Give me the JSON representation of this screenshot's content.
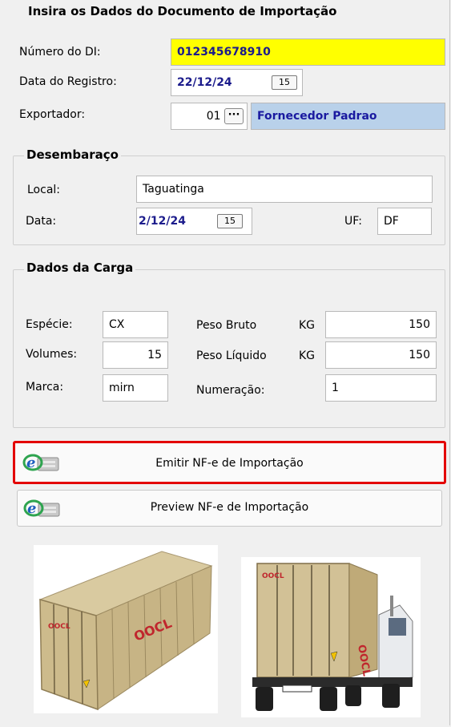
{
  "section_main": {
    "title": "Insira os Dados do Documento de Importação",
    "numero_di_label": "Número do DI:",
    "numero_di_value": "012345678910",
    "data_registro_label": "Data do Registro:",
    "data_registro_value": "22/12/24",
    "exportador_label": "Exportador:",
    "exportador_code": "01",
    "exportador_lookup": "···",
    "exportador_name": "Fornecedor Padrao",
    "calendar_glyph": "15"
  },
  "desembaraco": {
    "title": "Desembaraço",
    "local_label": "Local:",
    "local_value": "Taguatinga",
    "data_label": "Data:",
    "data_value": "2/12/24",
    "uf_label": "UF:",
    "uf_value": "DF"
  },
  "carga": {
    "title": "Dados da Carga",
    "especie_label": "Espécie:",
    "especie_value": "CX",
    "volumes_label": "Volumes:",
    "volumes_value": "15",
    "marca_label": "Marca:",
    "marca_value": "mirn",
    "peso_bruto_label": "Peso Bruto",
    "peso_bruto_unit": "KG",
    "peso_bruto_value": "150",
    "peso_liquido_label": "Peso Líquido",
    "peso_liquido_unit": "KG",
    "peso_liquido_value": "150",
    "numeracao_label": "Numeração:",
    "numeracao_value": "1"
  },
  "actions": {
    "emitir_label": "Emitir NF-e de Importação",
    "preview_label": "Preview NF-e de Importação",
    "highlight_color": "#e30000"
  },
  "illustrations": {
    "container_brand": "OOCL",
    "truck_brand": "OOCL"
  },
  "colors": {
    "highlight_yellow": "#ffff00",
    "lookup_blue": "#b9d1ea",
    "date_text": "#1c1c8c"
  }
}
